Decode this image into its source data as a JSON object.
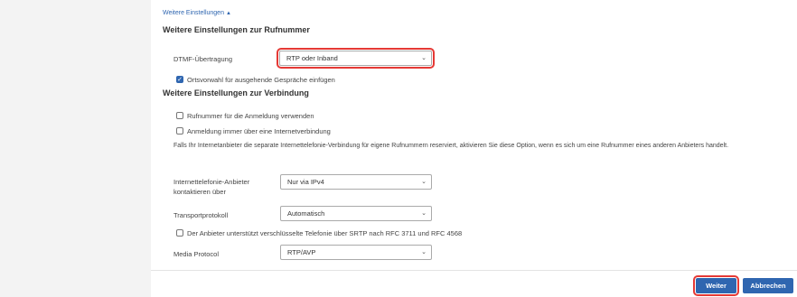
{
  "toggle_label": "Weitere Einstellungen",
  "section_number": {
    "title": "Weitere Einstellungen zur Rufnummer",
    "dtmf_label": "DTMF-Übertragung",
    "dtmf_value": "RTP oder Inband",
    "area_code_checkbox_label": "Ortsvorwahl für ausgehende Gespräche einfügen",
    "area_code_checked": true
  },
  "section_connection": {
    "title": "Weitere Einstellungen zur Verbindung",
    "use_number_for_login_label": "Rufnummer für die Anmeldung verwenden",
    "use_number_for_login_checked": false,
    "always_via_internet_label": "Anmeldung immer über eine Internetverbindung",
    "always_via_internet_checked": false,
    "description": "Falls Ihr Internetanbieter die separate Internettelefonie-Verbindung für eigene Rufnummern reserviert, aktivieren Sie diese Option, wenn es sich um eine Rufnummer eines anderen Anbieters handelt.",
    "contact_provider_label_line1": "Internettelefonie-Anbieter",
    "contact_provider_label_line2": "kontaktieren über",
    "contact_provider_value": "Nur via IPv4",
    "transport_label": "Transportprotokoll",
    "transport_value": "Automatisch",
    "srtp_label": "Der Anbieter unterstützt verschlüsselte Telefonie über SRTP nach RFC 3711 und RFC 4568",
    "srtp_checked": false,
    "media_protocol_label": "Media Protocol",
    "media_protocol_value": "RTP/AVP"
  },
  "buttons": {
    "next": "Weiter",
    "cancel": "Abbrechen"
  },
  "colors": {
    "accent": "#2f66b0",
    "highlight": "#e53935"
  },
  "icons": {
    "toggle": "triangle-up-icon",
    "select": "chevron-down-icon",
    "checkbox": "checkmark-icon"
  }
}
